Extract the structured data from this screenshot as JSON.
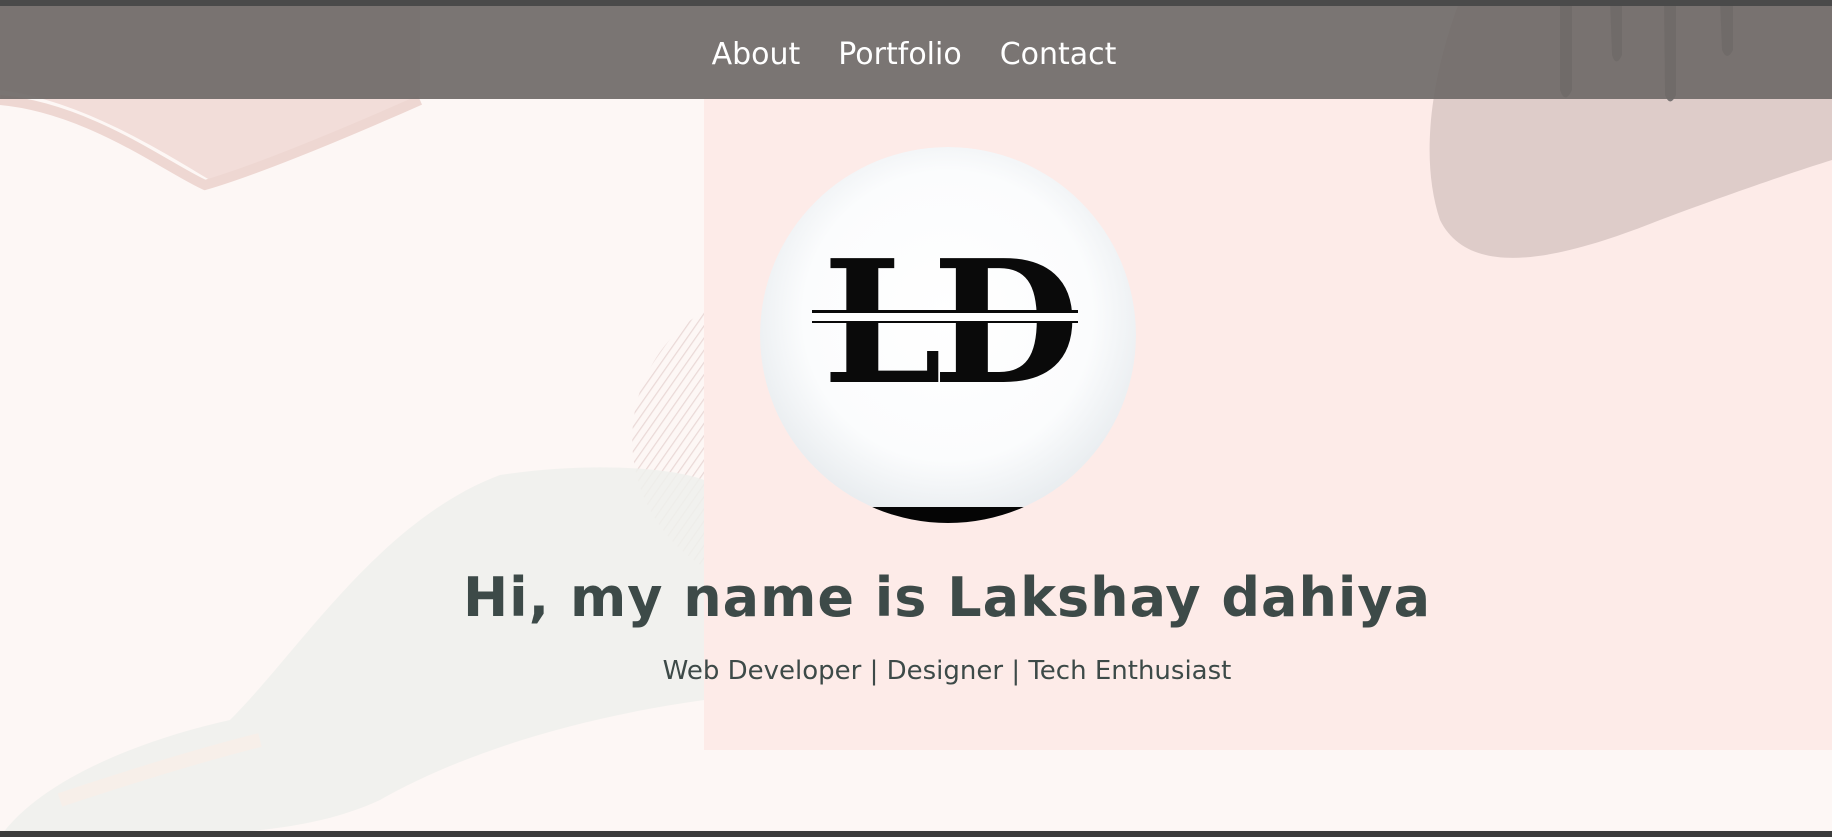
{
  "nav": {
    "items": [
      {
        "label": "About"
      },
      {
        "label": "Portfolio"
      },
      {
        "label": "Contact"
      }
    ]
  },
  "logo": {
    "text": "LD",
    "icon": "ld-monogram-logo"
  },
  "hero": {
    "headline": "Hi, my name is Lakshay dahiya",
    "tagline": "Web Developer | Designer | Tech Enthusiast"
  },
  "colors": {
    "navbar": "#706a68",
    "text": "#3d4a48",
    "background": "#fdf7f5",
    "panel": "#fdebe8"
  }
}
